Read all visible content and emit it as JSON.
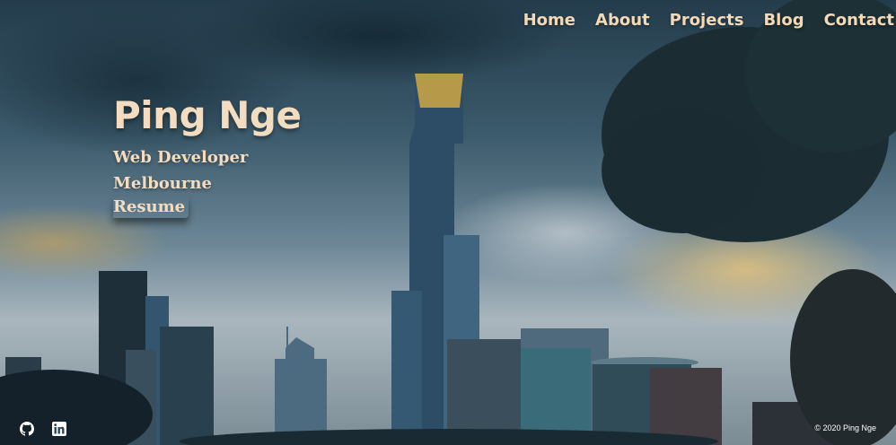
{
  "nav": {
    "items": [
      "Home",
      "About",
      "Projects",
      "Blog",
      "Contact"
    ]
  },
  "hero": {
    "name": "Ping Nge",
    "role": "Web Developer",
    "location": "Melbourne",
    "resume_link": "Resume"
  },
  "social": {
    "github_icon": "github-icon",
    "linkedin_icon": "linkedin-icon"
  },
  "footer": {
    "copyright": "© 2020 Ping Nge"
  },
  "colors": {
    "accent_text": "#f4dcc0",
    "sky_dark": "#243c4b"
  }
}
